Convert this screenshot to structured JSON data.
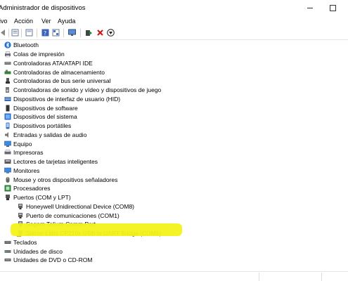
{
  "window": {
    "title": "Administrador de dispositivos"
  },
  "menu": {
    "file": "ivo",
    "action": "Acción",
    "view": "Ver",
    "help": "Ayuda"
  },
  "toolbar": {
    "buttons": [
      "back-icon",
      "forward-icon",
      "properties-icon",
      "view-icon",
      "help-icon",
      "device-view-icon",
      "monitor-icon",
      "enable-device-icon",
      "uninstall-icon",
      "update-driver-icon"
    ]
  },
  "tree": {
    "categories": [
      "Bluetooth",
      "Colas de impresión",
      "Controladoras ATA/ATAPI IDE",
      "Controladoras de almacenamiento",
      "Controladoras de bus serie universal",
      "Controladoras de sonido y vídeo y dispositivos de juego",
      "Dispositivos de interfaz de usuario (HID)",
      "Dispositivos de software",
      "Dispositivos del sistema",
      "Dispositivos portátiles",
      "Entradas y salidas de audio",
      "Equipo",
      "Impresoras",
      "Lectores de tarjetas inteligentes",
      "Monitores",
      "Mouse y otros dispositivos señaladores",
      "Procesadores",
      "Puertos (COM y LPT)"
    ],
    "ports_children": [
      "Honeywell Unidirectional Device (COM8)",
      "Puerto de comunicaciones (COM1)",
      "Sagem Telium Comm Port",
      "Silicon Labs CP210x USB to UART Bridge (COM5)"
    ],
    "after": [
      "Teclados",
      "Unidades de disco",
      "Unidades de DVD o CD-ROM"
    ]
  },
  "colors": {
    "highlight": "#f2f21a",
    "accent_blue": "#1e6fd9",
    "red_x": "#d01818",
    "green": "#1b8a2e"
  }
}
